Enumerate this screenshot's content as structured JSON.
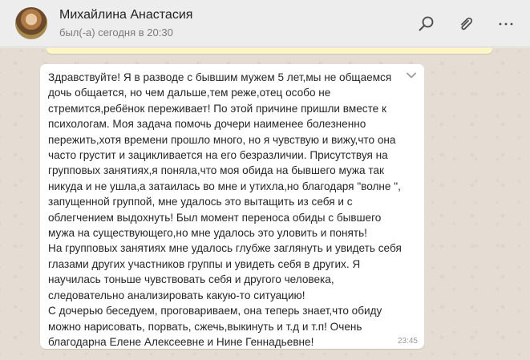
{
  "header": {
    "avatar_icon": "profile-photo",
    "contact_name": "Михайлина Анастасия",
    "status": "был(-а) сегодня в 20:30",
    "actions": [
      "search-icon",
      "paperclip-icon",
      "more-icon"
    ]
  },
  "message": {
    "text": "Здравствуйте! Я в разводе с бывшим мужем 5 лет,мы не общаемся\nдочь общается, но чем дальше,тем реже,отец особо не\nстремится,ребёнок переживает! По этой причине пришли вместе к\nпсихологам. Моя задача помочь дочери наименее болезненно\nпережить,хотя времени прошло много, но я чувствую и вижу,что она\nчасто грустит и зацикливается на его безразличии. Присутствуя на\nгрупповых занятиях,я поняла,что моя обида на бывшего мужа так\nникуда и не ушла,а затаилась во мне и утихла,но благодаря \"волне \",\nзапущенной группой, мне удалось это вытащить из себя и с\nоблегчением выдохнуть! Был момент переноса обиды с бывшего\nмужа на существующего,но мне удалось это уловить и понять!\nНа групповых занятиях мне удалось глубже заглянуть и увидеть себя\nглазами других участников группы и  увидеть себя в других. Я\nнаучилась тоньше чувствовать себя и другого человека,\nследовательно анализировать какую-то ситуацию!\nС дочерью беседуем, проговариваем, она теперь знает,что обиду\nможно нарисовать, порвать, сжечь,выкинуть и т.д и т.п! Очень\nблагодарна  Елене Алексеевне и Нине Геннадьевне!",
    "time": "23:45"
  },
  "colors": {
    "chat_background": "#e5ddd4",
    "bubble": "#ffffff",
    "header": "#ededed",
    "previous_bubble": "#fdf5c4"
  }
}
